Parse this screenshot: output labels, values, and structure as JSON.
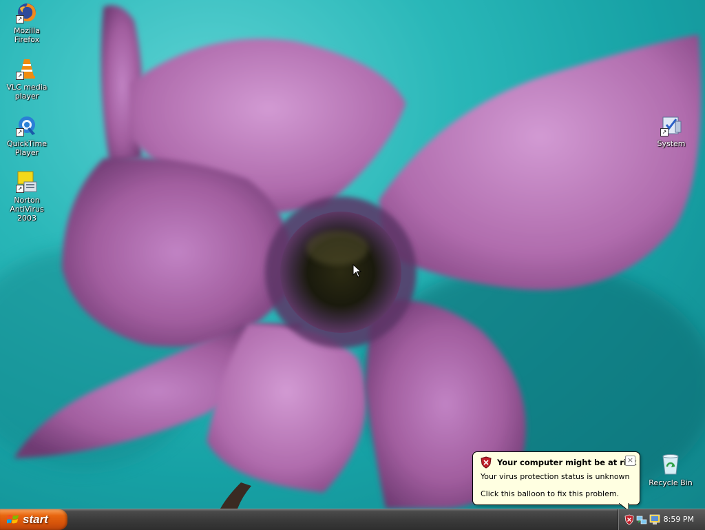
{
  "desktop_icons": [
    {
      "id": "firefox",
      "label": "Mozilla Firefox",
      "icon": "firefox-icon",
      "shortcut": true
    },
    {
      "id": "vlc",
      "label": "VLC media player",
      "icon": "vlc-icon",
      "shortcut": true
    },
    {
      "id": "quicktime",
      "label": "QuickTime Player",
      "icon": "quicktime-icon",
      "shortcut": true
    },
    {
      "id": "norton",
      "label": "Norton AntiVirus 2003",
      "icon": "norton-icon",
      "shortcut": true
    },
    {
      "id": "system",
      "label": "System",
      "icon": "system-icon",
      "shortcut": true
    },
    {
      "id": "recycle",
      "label": "Recycle Bin",
      "icon": "recycle-bin-icon",
      "shortcut": false
    }
  ],
  "taskbar": {
    "start_label": "start",
    "clock": "8:59 PM",
    "tray_icons": [
      "security-shield-icon",
      "network-icon",
      "display-icon"
    ]
  },
  "balloon": {
    "title": "Your computer might be at risk",
    "line1": "Your virus protection status is unknown",
    "line2": "Click this balloon to fix this problem.",
    "close_label": "×"
  },
  "colors": {
    "desktop_teal": "#1aa8ab",
    "petal_purple": "#a0579b",
    "start_orange": "#e0661a",
    "taskbar_gray": "#3b3b3b",
    "balloon_yellow": "#ffffe1"
  }
}
